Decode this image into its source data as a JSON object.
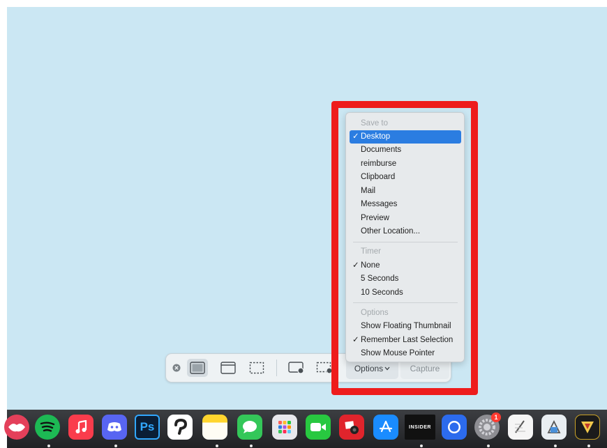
{
  "toolbar": {
    "close_icon": "close-icon",
    "options_label": "Options",
    "capture_label": "Capture"
  },
  "menu": {
    "save_to_header": "Save to",
    "save_to": [
      "Desktop",
      "Documents",
      "reimburse",
      "Clipboard",
      "Mail",
      "Messages",
      "Preview",
      "Other Location..."
    ],
    "timer_header": "Timer",
    "timer": [
      "None",
      "5 Seconds",
      "10 Seconds"
    ],
    "options_header": "Options",
    "options": [
      "Show Floating Thumbnail",
      "Remember Last Selection",
      "Show Mouse Pointer"
    ],
    "checked": [
      "Desktop",
      "None",
      "Remember Last Selection"
    ],
    "check_glyph": "✓"
  },
  "dock": {
    "icons": [
      "lips-app-icon",
      "spotify-icon",
      "music-icon",
      "discord-icon",
      "photoshop-icon",
      "clip-studio-icon",
      "notes-icon",
      "messages-icon",
      "launchpad-icon",
      "facetime-icon",
      "photo-booth-icon",
      "app-store-icon",
      "insider-icon",
      "signal-icon",
      "system-preferences-icon",
      "textedit-icon",
      "preview-icon",
      "game-icon"
    ],
    "photoshop_label": "Ps",
    "insider_label": "INSIDER",
    "system_preferences_badge": "1"
  },
  "colors": {
    "desktop": "#cbe7f3",
    "highlight_frame": "#ee1c1c",
    "menu_selection": "#2b7de1"
  }
}
